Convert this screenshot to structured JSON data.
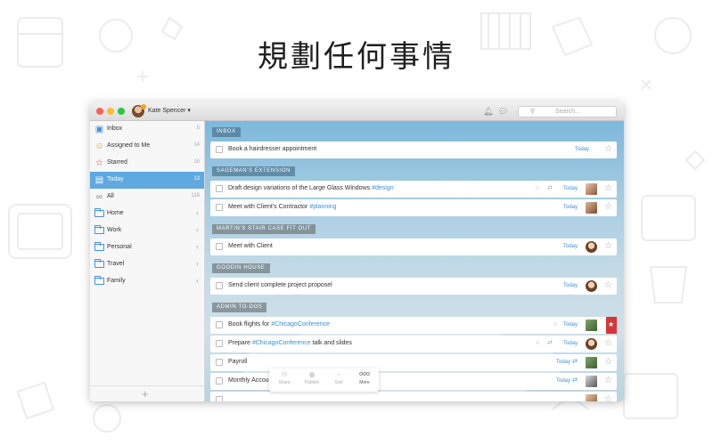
{
  "headline": "規劃任何事情",
  "window": {
    "user_name": "Kate Spencer ▾",
    "search_placeholder": "Search..."
  },
  "sidebar": {
    "items": [
      {
        "label": "Inbox",
        "count": "5",
        "icon": "inbox-icon"
      },
      {
        "label": "Assigned to Me",
        "count": "14",
        "icon": "person-icon"
      },
      {
        "label": "Starred",
        "count": "16",
        "icon": "star-icon"
      },
      {
        "label": "Today",
        "count": "13",
        "icon": "calendar-icon"
      },
      {
        "label": "All",
        "count": "118",
        "icon": "infinity-icon"
      },
      {
        "label": "Home",
        "icon": "folder-icon"
      },
      {
        "label": "Work",
        "icon": "folder-icon"
      },
      {
        "label": "Personal",
        "icon": "folder-icon"
      },
      {
        "label": "Travel",
        "icon": "folder-icon"
      },
      {
        "label": "Family",
        "icon": "folder-icon"
      }
    ],
    "active_index": 3,
    "add_label": "+"
  },
  "sections": [
    {
      "label": "INBOX"
    },
    {
      "label": "SAGEMAN'S EXTENSION"
    },
    {
      "label": "MARTIN'S STAIR CASE FIT OUT"
    },
    {
      "label": "GOODIN HOUSE"
    },
    {
      "label": "ADMIN TO-DOS"
    }
  ],
  "tasks": [
    {
      "title": "Book a hairdresser appointment",
      "tag": "",
      "due": "Today"
    },
    {
      "title": "Draft design variations of the Large Glass Windows ",
      "tag": "#design",
      "due": "Today"
    },
    {
      "title": "Meet with Client's Contractor ",
      "tag": "#planning",
      "due": "Today"
    },
    {
      "title": "Meet with Client",
      "tag": "",
      "due": "Today"
    },
    {
      "title": "Send client complete project proposel",
      "tag": "",
      "due": "Today"
    },
    {
      "title": "Book flights for ",
      "tag": "#ChicagoConference",
      "due": "Today",
      "starred": true
    },
    {
      "title": "Prepare ",
      "tag": "#ChicagoConference",
      "title_after": " talk and slides",
      "due": "Today"
    },
    {
      "title": "Payroll",
      "tag": "",
      "due": "Today"
    },
    {
      "title": "Monthly Accounting",
      "tag": "",
      "due": "Today"
    }
  ],
  "toolbar": {
    "share": "Share",
    "publish": "Publish",
    "sort": "Sort",
    "more": "More",
    "more_glyph": "ooo"
  },
  "colors": {
    "accent": "#5da9e0",
    "tag": "#3b8fd6",
    "star_flag": "#d6373a"
  }
}
